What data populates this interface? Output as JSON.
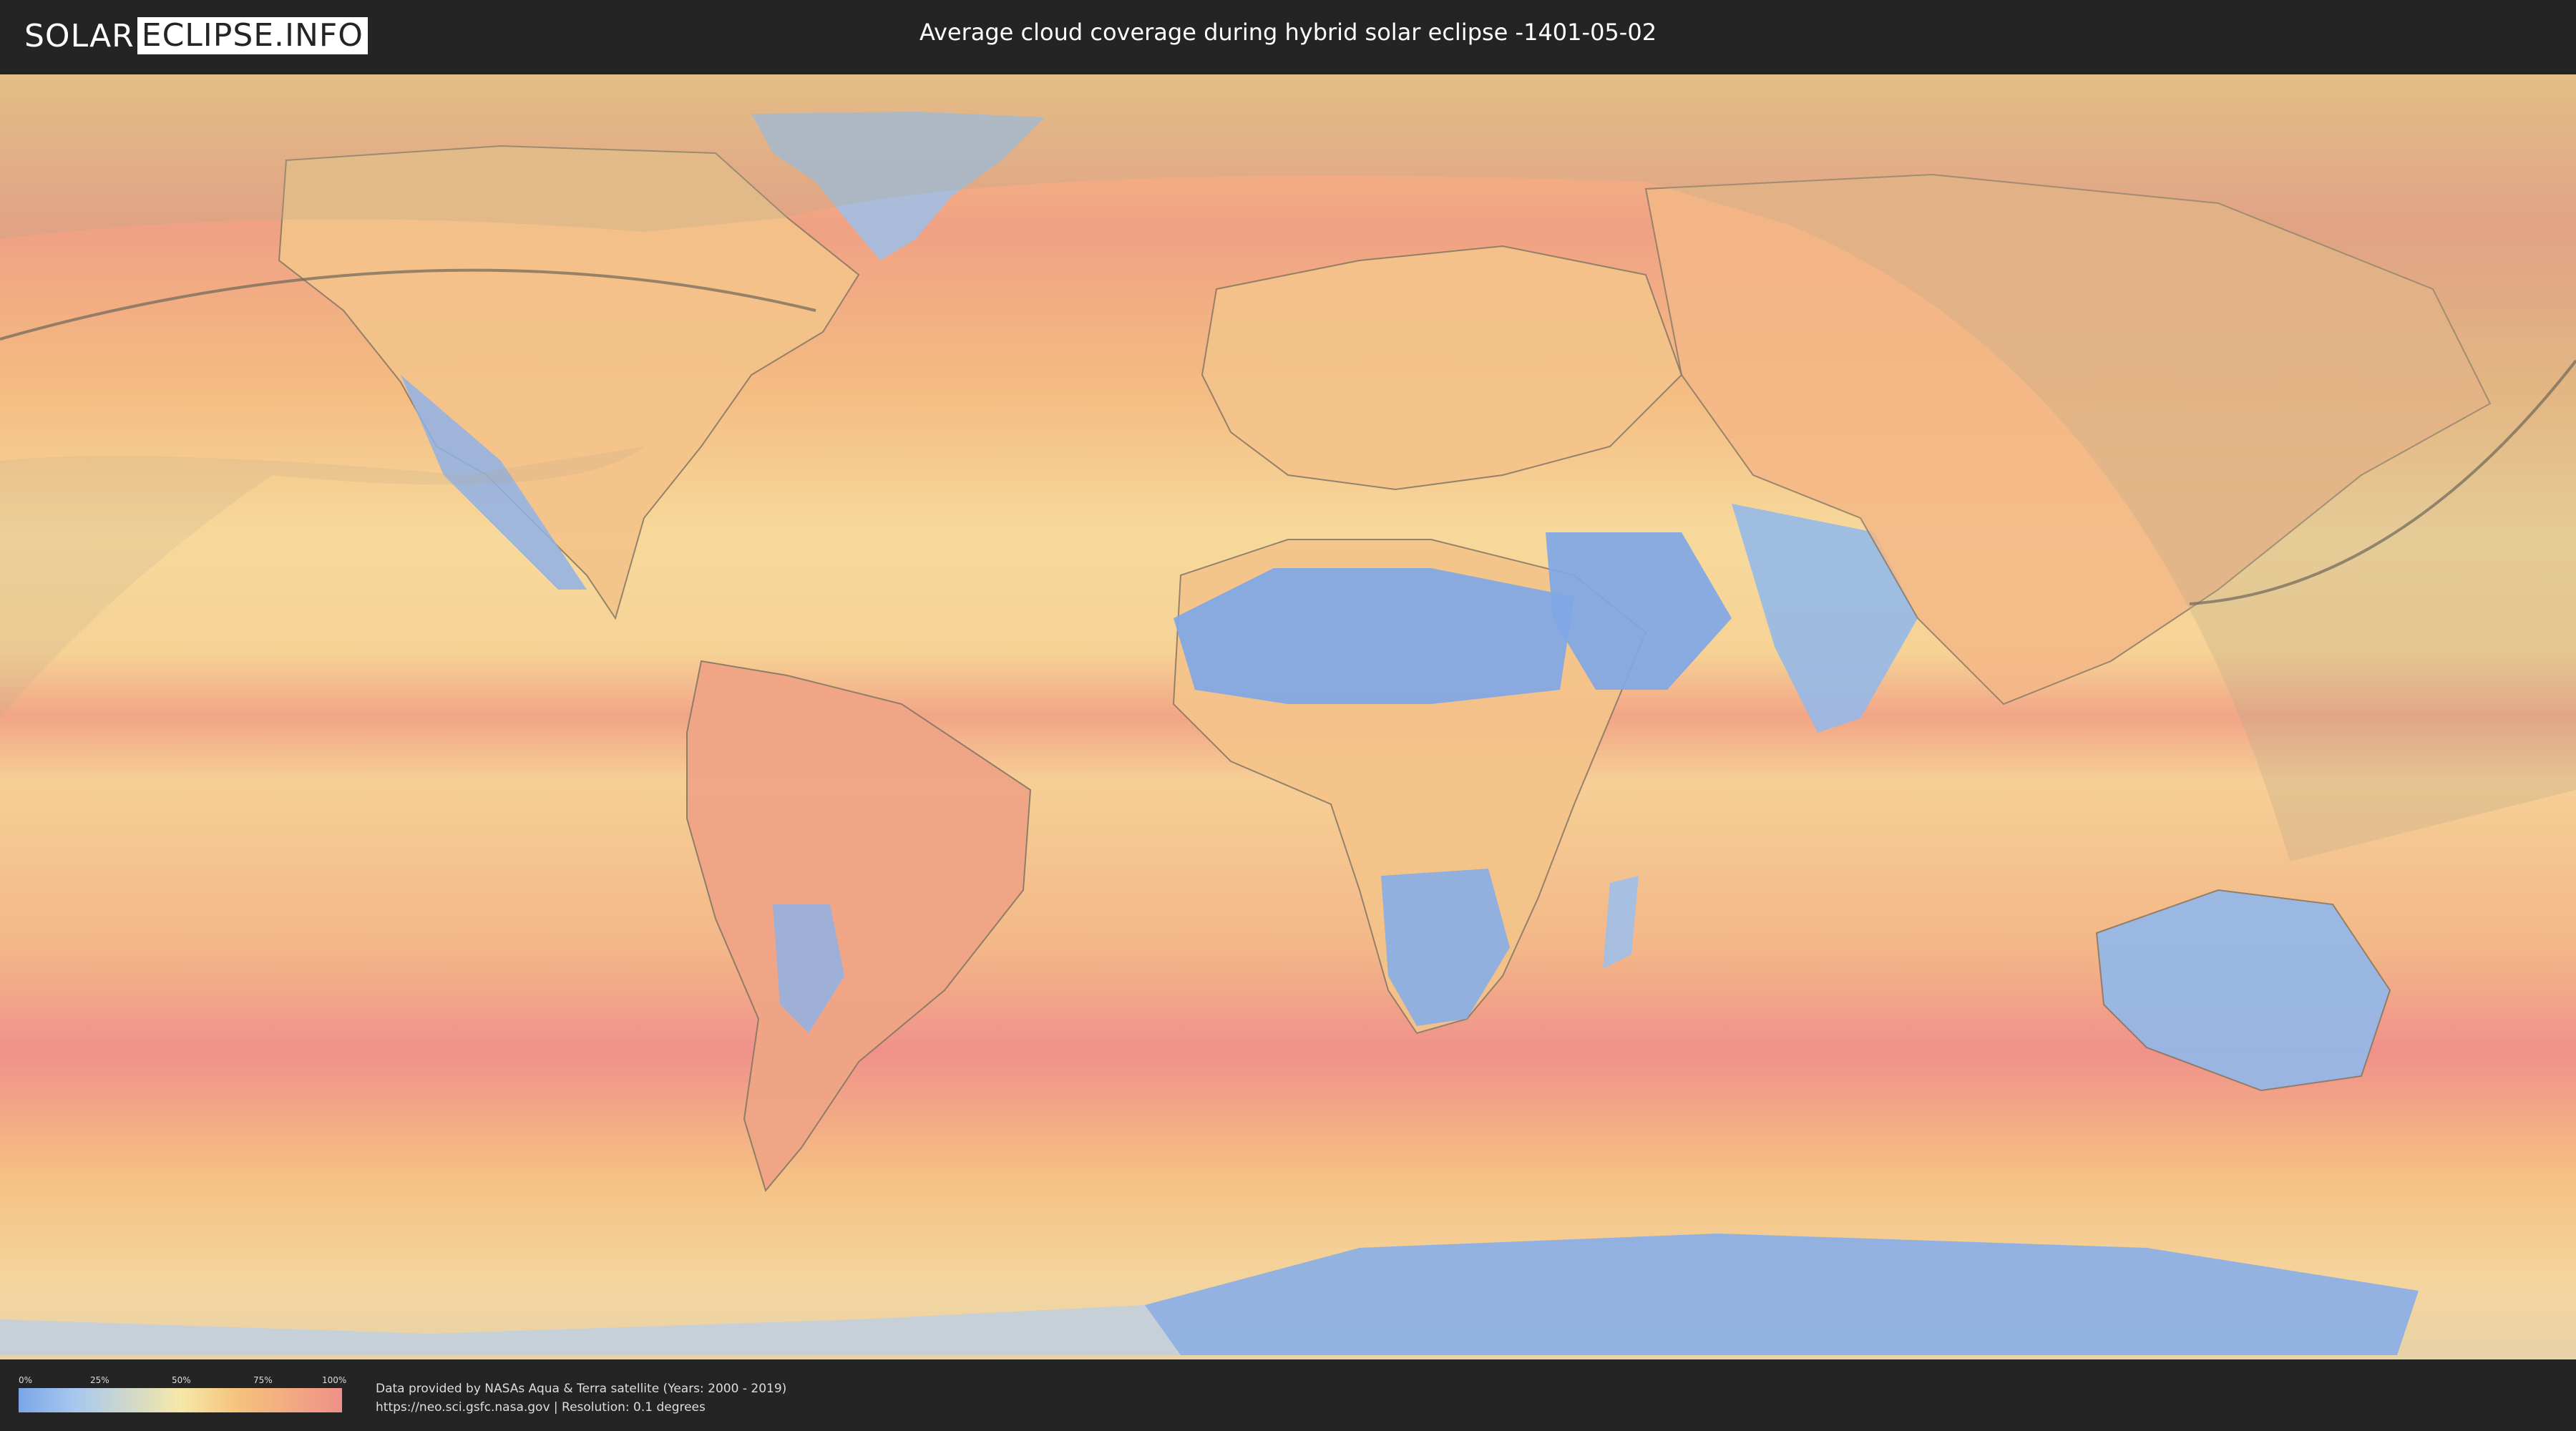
{
  "header": {
    "logo_left": "SOLAR",
    "logo_right": "ECLIPSE.INFO",
    "title": "Average cloud coverage during hybrid solar eclipse -1401-05-02"
  },
  "map": {
    "description": "World map, equirectangular, average cloud coverage colors",
    "colors": {
      "clear": "#7aa6e8",
      "low": "#a9c8ee",
      "medium": "#f6e8a8",
      "high": "#f5c27c",
      "overcast": "#f09088",
      "shadow_overlay": "#b8a88a"
    }
  },
  "legend": {
    "ticks": [
      "0%",
      "25%",
      "50%",
      "75%",
      "100%"
    ]
  },
  "credits": {
    "line1": "Data provided by NASAs Aqua & Terra satellite (Years: 2000 - 2019)",
    "line2": "https://neo.sci.gsfc.nasa.gov | Resolution: 0.1 degrees"
  }
}
